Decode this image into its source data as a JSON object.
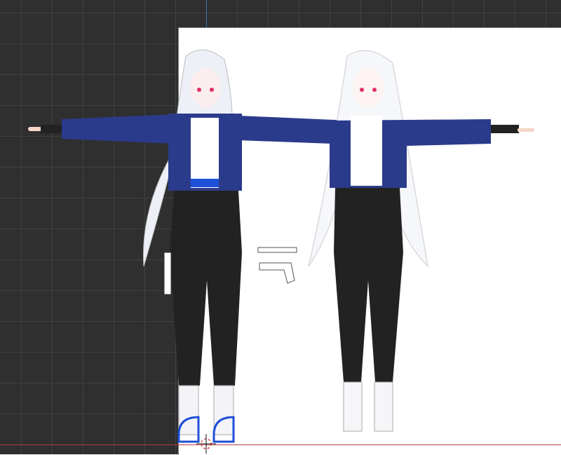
{
  "viewport": {
    "background_color": "#2f2f2f",
    "grid_color": "#414141",
    "axis_x_color": "#b53a44",
    "axis_y_color": "#3d6fb8"
  },
  "reference_image": {
    "background_color": "#ffffff"
  },
  "model": {
    "jacket_color": "#2b3b8c",
    "accent_color": "#1e4fd8",
    "pants_color": "#222222",
    "hair_color": "#eef0f8"
  }
}
